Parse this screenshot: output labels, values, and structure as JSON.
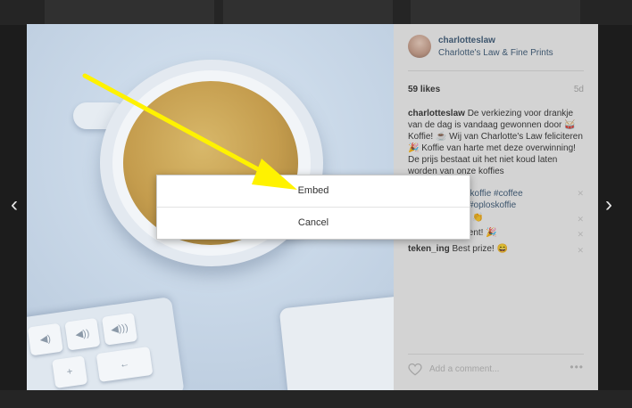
{
  "post": {
    "username": "charlotteslaw",
    "location": "Charlotte's Law & Fine Prints",
    "likes": "59 likes",
    "age": "5d",
    "caption_user": "charlotteslaw",
    "caption_text": "De verkiezing voor drankje van de dag is vandaag gewonnen door 🥁 Koffie! ☕ Wij van Charlotte's Law feliciteren 🎉 Koffie van harte met deze overwinning! De prijs bestaat uit het niet koud laten worden van onze koffies",
    "hashtags_1": "#koffie #coffee",
    "hashtags_2": "#oploskoffie",
    "comment_fragment_1": "👏",
    "comment_fragment_2": "inent! 🎉",
    "comment_user": "teken_ing",
    "comment_text": "Best prize! 😄",
    "add_comment_placeholder": "Add a comment...",
    "more": "•••"
  },
  "nav": {
    "prev": "‹",
    "next": "›"
  },
  "dialog": {
    "embed_label": "Embed",
    "cancel_label": "Cancel"
  },
  "keys": {
    "k1": "◀)",
    "k2": "◀))",
    "k3": "◀)))",
    "k4": "+",
    "k5": "←"
  },
  "colors": {
    "arrow": "#fff200",
    "link": "#3d5b78"
  },
  "icons": {
    "heart": "heart-icon",
    "more": "more-options-icon",
    "prev": "chevron-left-icon",
    "next": "chevron-right-icon",
    "arrow": "annotation-arrow-icon"
  }
}
